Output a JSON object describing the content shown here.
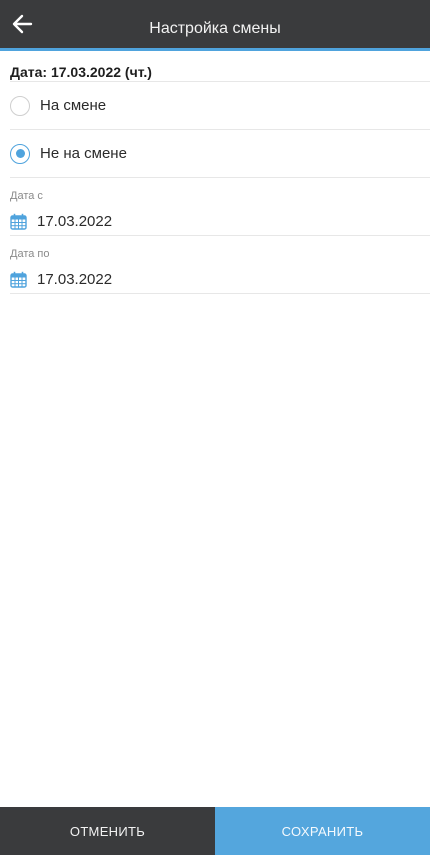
{
  "header": {
    "title": "Настройка смены",
    "back_icon": "arrow-left-icon"
  },
  "date_header": "Дата: 17.03.2022 (чт.)",
  "shift_options": [
    {
      "label": "На смене",
      "selected": false
    },
    {
      "label": "Не на смене",
      "selected": true
    }
  ],
  "fields": {
    "date_from": {
      "caption": "Дата с",
      "value": "17.03.2022",
      "icon": "calendar-icon"
    },
    "date_to": {
      "caption": "Дата по",
      "value": "17.03.2022",
      "icon": "calendar-icon"
    }
  },
  "footer": {
    "cancel_label": "ОТМЕНИТЬ",
    "save_label": "СОХРАНИТЬ"
  },
  "colors": {
    "topbar": "#3a3b3d",
    "accent": "#4fa3dd",
    "save_button": "#54a6dd"
  }
}
